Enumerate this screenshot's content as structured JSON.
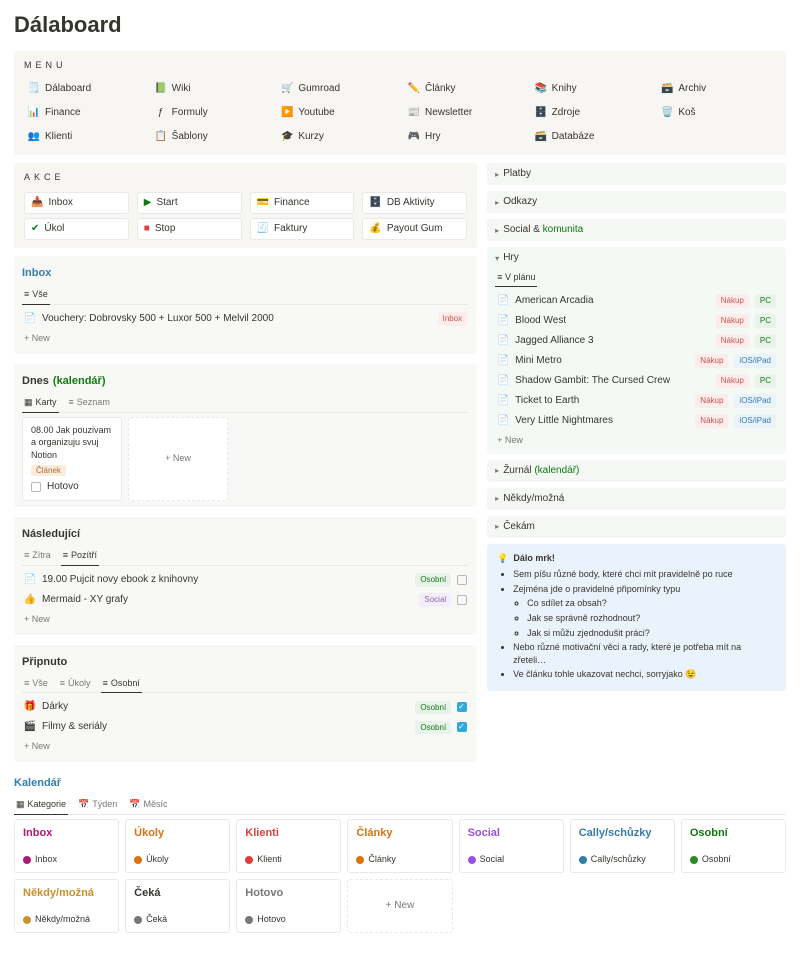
{
  "page_title": "Dálaboard",
  "menu": {
    "header": "MENU",
    "items": [
      {
        "icon": "🗒️",
        "label": "Dálaboard"
      },
      {
        "icon": "📗",
        "label": "Wiki"
      },
      {
        "icon": "🛒",
        "label": "Gumroad"
      },
      {
        "icon": "✏️",
        "label": "Články"
      },
      {
        "icon": "📚",
        "label": "Knihy"
      },
      {
        "icon": "🗃️",
        "label": "Archiv"
      },
      {
        "icon": "📊",
        "label": "Finance"
      },
      {
        "icon": "ƒ",
        "label": "Formuly"
      },
      {
        "icon": "▶️",
        "label": "Youtube"
      },
      {
        "icon": "📰",
        "label": "Newsletter"
      },
      {
        "icon": "🗄️",
        "label": "Zdroje"
      },
      {
        "icon": "🗑️",
        "label": "Koš"
      },
      {
        "icon": "👥",
        "label": "Klienti"
      },
      {
        "icon": "📋",
        "label": "Šablony"
      },
      {
        "icon": "🎓",
        "label": "Kurzy"
      },
      {
        "icon": "🎮",
        "label": "Hry"
      },
      {
        "icon": "🗃️",
        "label": "Databáze"
      }
    ]
  },
  "actions": {
    "header": "AKCE",
    "items": [
      {
        "icon": "📥",
        "label": "Inbox",
        "color": "c-purple"
      },
      {
        "icon": "▶",
        "label": "Start",
        "color": "c-green"
      },
      {
        "icon": "💳",
        "label": "Finance",
        "color": "c-muted"
      },
      {
        "icon": "🗄️",
        "label": "DB Aktivity",
        "color": ""
      },
      {
        "icon": "✔",
        "label": "Úkol",
        "color": "c-green"
      },
      {
        "icon": "■",
        "label": "Stop",
        "color": "c-red"
      },
      {
        "icon": "🧾",
        "label": "Faktury",
        "color": "c-muted"
      },
      {
        "icon": "💰",
        "label": "Payout Gum",
        "color": "c-purple"
      }
    ]
  },
  "inbox": {
    "title": "Inbox",
    "tab": "Vše",
    "items": [
      {
        "icon": "📄",
        "label": "Vouchery: Dobrovsky 500 + Luxor 500 + Melvil 2000",
        "tag": "Inbox"
      }
    ],
    "new": "+ New"
  },
  "dnes": {
    "title": "Dnes",
    "paren": "(kalendář)",
    "tabs": [
      {
        "icon": "▦",
        "label": "Karty",
        "active": true
      },
      {
        "icon": "≡",
        "label": "Seznam",
        "active": false
      }
    ],
    "card": {
      "title": "08.00 Jak pouzivam a organizuju svuj Notion",
      "tag": "Článek",
      "checkbox": "Hotovo"
    },
    "new": "+ New"
  },
  "nasledujici": {
    "title": "Následující",
    "tabs": [
      {
        "icon": "≡",
        "label": "Zítra",
        "active": false
      },
      {
        "icon": "≡",
        "label": "Pozítří",
        "active": true
      }
    ],
    "items": [
      {
        "icon": "📄",
        "label": "19.00 Pujcit novy ebook z knihovny",
        "tag": "Osobní",
        "tagc": "osobni",
        "chk": false
      },
      {
        "icon": "👍",
        "label": "Mermaid - XY grafy",
        "tag": "Social",
        "tagc": "social",
        "chk": false
      }
    ],
    "new": "+ New"
  },
  "pripnuto": {
    "title": "Připnuto",
    "tabs": [
      {
        "icon": "≡",
        "label": "Vše",
        "active": false
      },
      {
        "icon": "≡",
        "label": "Úkoly",
        "active": false
      },
      {
        "icon": "≡",
        "label": "Osobní",
        "active": true
      }
    ],
    "items": [
      {
        "icon": "🎁",
        "label": "Dárky",
        "tag": "Osobní",
        "tagc": "osobni",
        "chk": true
      },
      {
        "icon": "🎬",
        "label": "Filmy & seriály",
        "tag": "Osobní",
        "tagc": "osobni",
        "chk": true
      }
    ],
    "new": "+ New"
  },
  "side": {
    "platby": "Platby",
    "odkazy": "Odkazy",
    "social": {
      "a": "Social &",
      "b": "komunita"
    },
    "hry": {
      "title": "Hry",
      "tab": "V plánu",
      "items": [
        {
          "label": "American Arcadia",
          "tags": [
            "Nákup",
            "PC"
          ]
        },
        {
          "label": "Blood West",
          "tags": [
            "Nákup",
            "PC"
          ]
        },
        {
          "label": "Jagged Alliance 3",
          "tags": [
            "Nákup",
            "PC"
          ]
        },
        {
          "label": "Mini Metro",
          "tags": [
            "Nákup",
            "iOS/iPad"
          ]
        },
        {
          "label": "Shadow Gambit: The Cursed Crew",
          "tags": [
            "Nákup",
            "PC"
          ]
        },
        {
          "label": "Ticket to Earth",
          "tags": [
            "Nákup",
            "iOS/iPad"
          ]
        },
        {
          "label": "Very Little Nightmares",
          "tags": [
            "Nákup",
            "iOS/iPad"
          ]
        }
      ],
      "new": "+ New"
    },
    "zurnal": {
      "a": "Žurnál",
      "b": "(kalendář)"
    },
    "nekdy": "Někdy/možná",
    "cekam": "Čekám",
    "callout": {
      "title": "Dálo mrk!",
      "b1": "Sem píšu různé body, které chci mít pravidelně po ruce",
      "b2": "Zejména jde o pravidelné připomínky typu",
      "s1": "Co sdílet za obsah?",
      "s2": "Jak se správně rozhodnout?",
      "s3": "Jak si můžu zjednodušit práci?",
      "b3": "Nebo různé motivační věci a rady, které je potřeba mít na zřeteli…",
      "b4": "Ve článku tohle ukazovat nechci, sorryjako 😉"
    }
  },
  "kalendar": {
    "title": "Kalendář",
    "tabs": [
      {
        "icon": "▦",
        "label": "Kategorie",
        "active": true
      },
      {
        "icon": "📅",
        "label": "Týden",
        "active": false
      },
      {
        "icon": "📅",
        "label": "Měsíc",
        "active": false
      }
    ],
    "cards": [
      {
        "title": "Inbox",
        "tc": "c-pink",
        "dot": "d-pink",
        "b": "Inbox"
      },
      {
        "title": "Úkoly",
        "tc": "c-orange",
        "dot": "d-orange",
        "b": "Úkoly"
      },
      {
        "title": "Klienti",
        "tc": "c-red",
        "dot": "d-red",
        "b": "Klienti"
      },
      {
        "title": "Články",
        "tc": "c-orange",
        "dot": "d-orange",
        "b": "Články"
      },
      {
        "title": "Social",
        "tc": "c-purple",
        "dot": "d-purple",
        "b": "Social"
      },
      {
        "title": "Cally/schůzky",
        "tc": "c-blue",
        "dot": "d-blue",
        "b": "Cally/schůzky"
      },
      {
        "title": "Osobní",
        "tc": "c-green",
        "dot": "d-green",
        "b": "Osobní"
      },
      {
        "title": "Někdy/možná",
        "tc": "c-yellow",
        "dot": "d-yellow",
        "b": "Někdy/možná"
      },
      {
        "title": "Čeká",
        "tc": "",
        "dot": "d-gray",
        "b": "Čeká"
      },
      {
        "title": "Hotovo",
        "tc": "c-muted",
        "dot": "d-gray",
        "b": "Hotovo"
      }
    ],
    "new": "+ New"
  }
}
